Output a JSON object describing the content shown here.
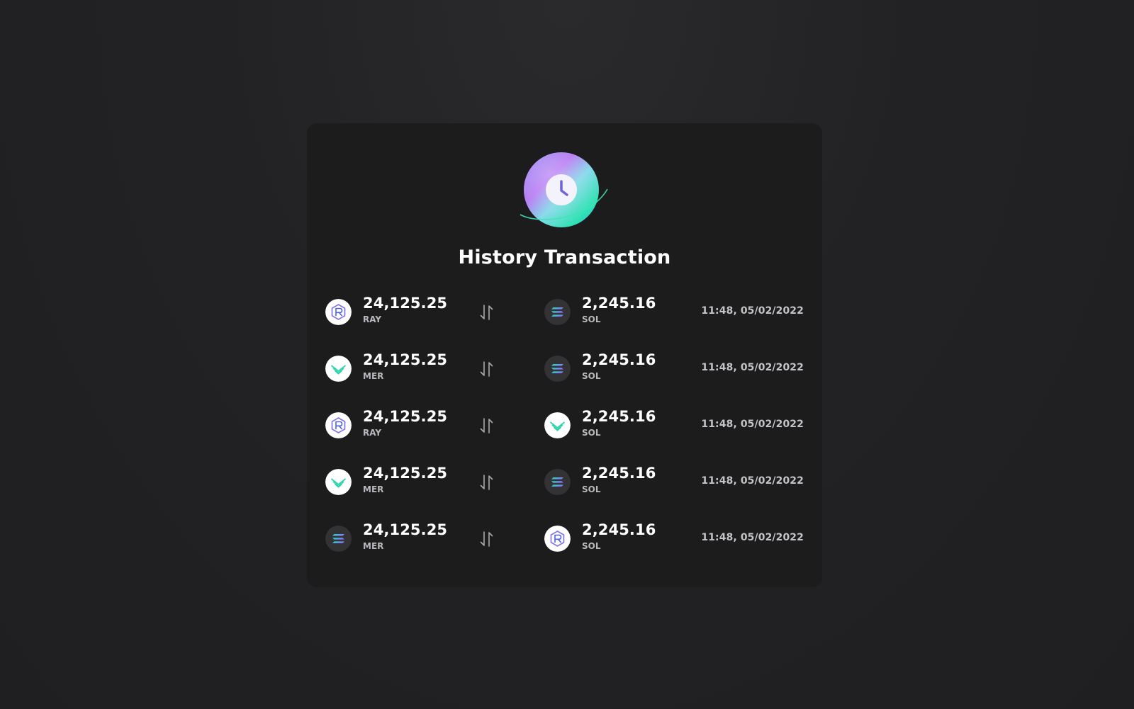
{
  "card": {
    "title": "History Transaction",
    "hero_icon": "clock-icon"
  },
  "colors": {
    "background": "#222224",
    "card": "#1c1c1d",
    "text_primary": "#ffffff",
    "text_secondary": "#b9b9bd",
    "ray_accent": "#5b63e8",
    "mer_accent": "#2fd3b0",
    "sol_gradient_start": "#14f195",
    "sol_gradient_end": "#dc1fff"
  },
  "transactions": [
    {
      "from": {
        "icon": "ray-token-icon",
        "token": "ray",
        "amount": "24,125.25",
        "symbol": "RAY"
      },
      "to": {
        "icon": "sol-token-icon",
        "token": "sol",
        "amount": "2,245.16",
        "symbol": "SOL"
      },
      "time": "11:48, 05/02/2022"
    },
    {
      "from": {
        "icon": "mer-token-icon",
        "token": "mer",
        "amount": "24,125.25",
        "symbol": "MER"
      },
      "to": {
        "icon": "sol-token-icon",
        "token": "sol",
        "amount": "2,245.16",
        "symbol": "SOL"
      },
      "time": "11:48, 05/02/2022"
    },
    {
      "from": {
        "icon": "ray-token-icon",
        "token": "ray",
        "amount": "24,125.25",
        "symbol": "RAY"
      },
      "to": {
        "icon": "mer-token-icon",
        "token": "mer",
        "amount": "2,245.16",
        "symbol": "SOL"
      },
      "time": "11:48, 05/02/2022"
    },
    {
      "from": {
        "icon": "mer-token-icon",
        "token": "mer",
        "amount": "24,125.25",
        "symbol": "MER"
      },
      "to": {
        "icon": "sol-token-icon",
        "token": "sol",
        "amount": "2,245.16",
        "symbol": "SOL"
      },
      "time": "11:48, 05/02/2022"
    },
    {
      "from": {
        "icon": "sol-token-icon",
        "token": "sol",
        "amount": "24,125.25",
        "symbol": "MER"
      },
      "to": {
        "icon": "ray-token-icon",
        "token": "ray",
        "amount": "2,245.16",
        "symbol": "SOL"
      },
      "time": "11:48, 05/02/2022"
    }
  ]
}
